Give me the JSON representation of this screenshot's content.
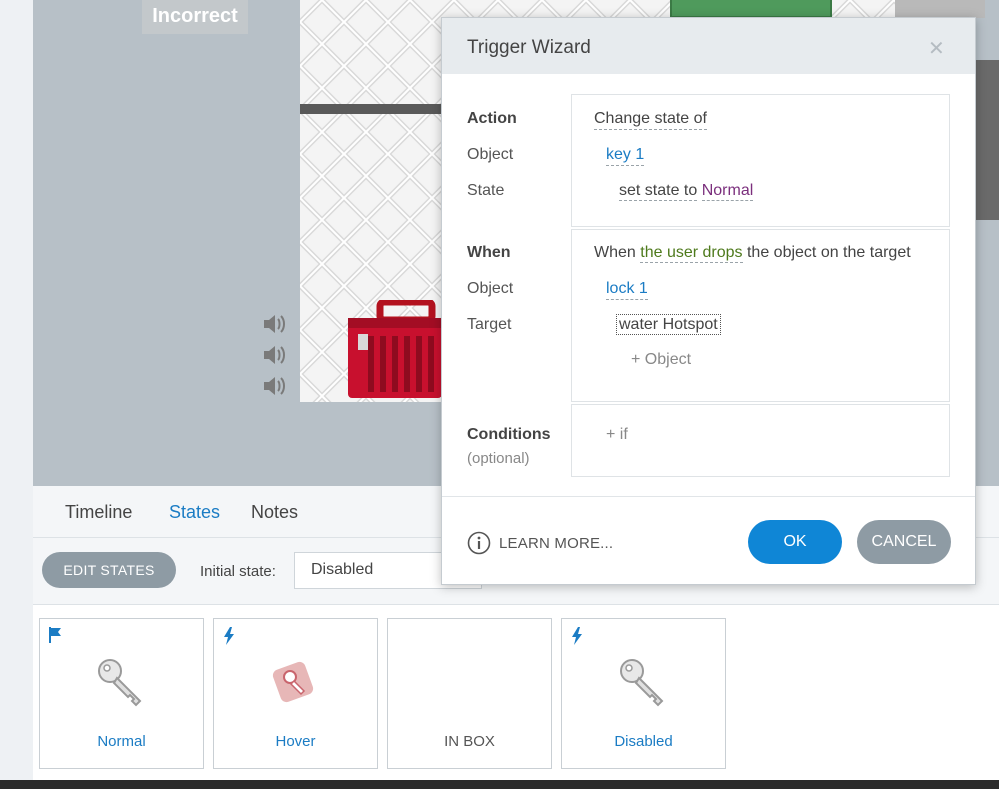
{
  "stage": {
    "feedback_label": "Incorrect",
    "speaker_icon": "speaker-icon",
    "toolbox_icon": "red-toolbox"
  },
  "panel": {
    "tabs": [
      {
        "label": "Timeline",
        "active": false
      },
      {
        "label": "States",
        "active": true
      },
      {
        "label": "Notes",
        "active": false
      }
    ],
    "edit_states_label": "EDIT STATES",
    "initial_state_label": "Initial state:",
    "initial_state_value": "Disabled",
    "states": [
      {
        "label": "Normal",
        "badge": "flag-icon",
        "icon": "key-icon"
      },
      {
        "label": "Hover",
        "badge": "lightning-icon",
        "icon": "key-hover-icon"
      },
      {
        "label": "IN BOX",
        "badge": "",
        "icon": ""
      },
      {
        "label": "Disabled",
        "badge": "lightning-icon",
        "icon": "key-icon"
      }
    ]
  },
  "dialog": {
    "title": "Trigger Wizard",
    "close_icon": "close-icon",
    "action": {
      "label": "Action",
      "value": "Change state of",
      "object_label": "Object",
      "object_value": "key 1",
      "state_label": "State",
      "state_prefix": "set state to",
      "state_value": "Normal"
    },
    "when": {
      "label": "When",
      "text_before": "When",
      "event": "the user drops",
      "text_after": "the object on the target",
      "object_label": "Object",
      "object_value": "lock 1",
      "target_label": "Target",
      "target_value": "water Hotspot",
      "add_object": "+ Object"
    },
    "conditions": {
      "label": "Conditions",
      "sublabel": "(optional)",
      "add_if": "+ if"
    },
    "learn_more": "LEARN MORE...",
    "ok_label": "OK",
    "cancel_label": "CANCEL"
  },
  "colors": {
    "accent": "#1b7cc4",
    "ok_button": "#0f86d6",
    "secondary_button": "#8e9ba4",
    "state_value": "#7b2f7d",
    "event_value": "#4e7a1c"
  }
}
